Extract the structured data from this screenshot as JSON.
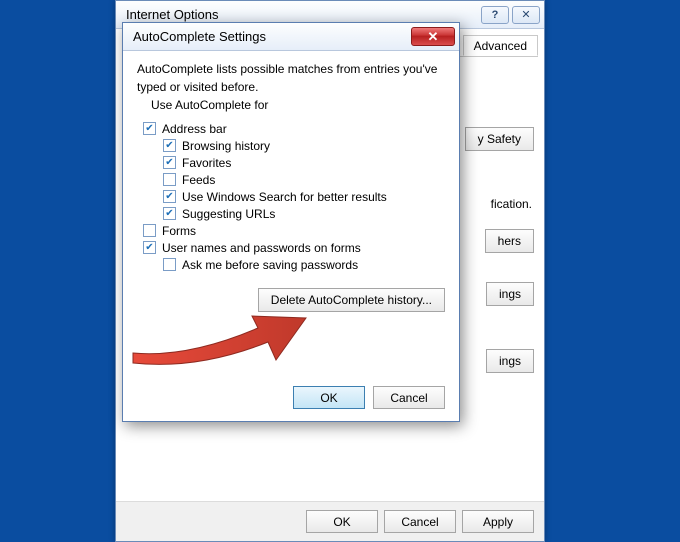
{
  "parent": {
    "title": "Internet Options",
    "tabs": {
      "advanced": "Advanced"
    },
    "partial": {
      "safety_btn": "y Safety",
      "fication_text": "fication.",
      "hers_btn": "hers",
      "ings_btn1": "ings",
      "ings_btn2": "ings"
    },
    "buttons": {
      "ok": "OK",
      "cancel": "Cancel",
      "apply": "Apply"
    }
  },
  "child": {
    "title": "AutoComplete Settings",
    "desc_line1": "AutoComplete lists possible matches from entries you've",
    "desc_line2": "typed or visited before.",
    "use_label": "Use AutoComplete for",
    "checks": {
      "address_bar": {
        "label": "Address bar",
        "checked": true
      },
      "browsing_history": {
        "label": "Browsing history",
        "checked": true
      },
      "favorites": {
        "label": "Favorites",
        "checked": true
      },
      "feeds": {
        "label": "Feeds",
        "checked": false
      },
      "windows_search": {
        "label": "Use Windows Search for better results",
        "checked": true
      },
      "suggesting_urls": {
        "label": "Suggesting URLs",
        "checked": true
      },
      "forms": {
        "label": "Forms",
        "checked": false
      },
      "user_pass": {
        "label": "User names and passwords on forms",
        "checked": true
      },
      "ask_before": {
        "label": "Ask me before saving passwords",
        "checked": false
      }
    },
    "delete_btn": "Delete AutoComplete history...",
    "ok": "OK",
    "cancel": "Cancel"
  }
}
